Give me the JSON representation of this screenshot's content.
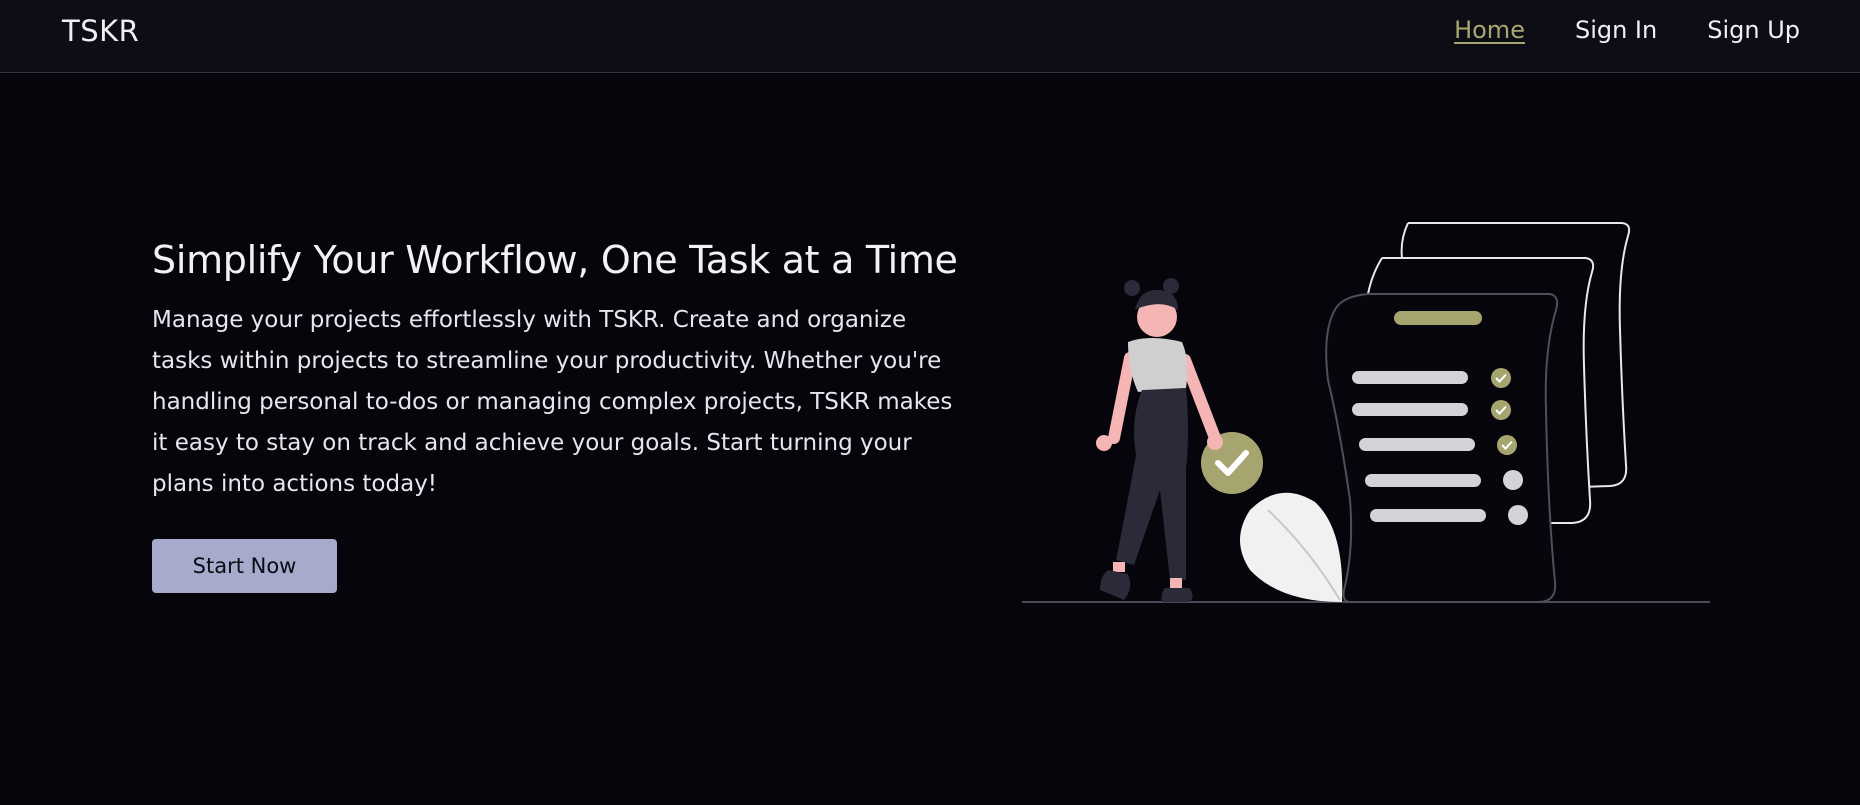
{
  "navbar": {
    "brand": "TSKR",
    "links": [
      {
        "label": "Home",
        "active": true
      },
      {
        "label": "Sign In",
        "active": false
      },
      {
        "label": "Sign Up",
        "active": false
      }
    ]
  },
  "hero": {
    "title": "Simplify Your Workflow, One Task at a Time",
    "description": "Manage your projects effortlessly with TSKR. Create and organize tasks within projects to streamline your productivity. Whether you're handling personal to-dos or managing complex projects, TSKR makes it easy to stay on track and achieve your goals. Start turning your plans into actions today!",
    "cta_label": "Start Now"
  },
  "illustration": {
    "icon": "task-checklist-woman-illustration",
    "checked_items": 3,
    "total_items": 5
  },
  "colors": {
    "background": "#05050b",
    "navbar": "#0d0d16",
    "accent_olive": "#a9a670",
    "button": "#a6aacb"
  }
}
